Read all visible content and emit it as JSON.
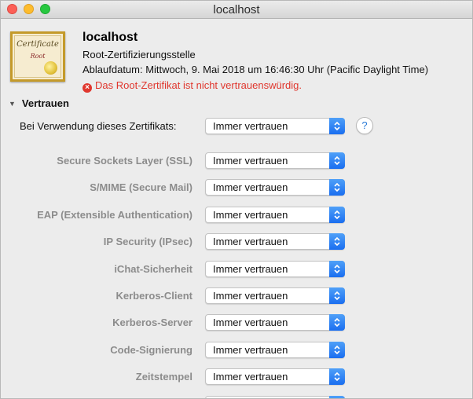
{
  "window": {
    "title": "localhost"
  },
  "certificate": {
    "icon_word": "Certificate",
    "icon_sub": "Root",
    "name": "localhost",
    "kind": "Root-Zertifizierungsstelle",
    "expiry": "Ablaufdatum: Mittwoch, 9. Mai 2018 um 16:46:30 Uhr (Pacific Daylight Time)",
    "status": "Das Root-Zertifikat ist nicht vertrauenswürdig.",
    "status_color": "#e0372e"
  },
  "trust": {
    "section_label": "Vertrauen",
    "main_label": "Bei Verwendung dieses Zertifikats:",
    "main_value": "Immer vertrauen",
    "help_label": "?",
    "rows": [
      {
        "label": "Secure Sockets Layer (SSL)",
        "value": "Immer vertrauen"
      },
      {
        "label": "S/MIME (Secure Mail)",
        "value": "Immer vertrauen"
      },
      {
        "label": "EAP (Extensible Authentication)",
        "value": "Immer vertrauen"
      },
      {
        "label": "IP Security (IPsec)",
        "value": "Immer vertrauen"
      },
      {
        "label": "iChat-Sicherheit",
        "value": "Immer vertrauen"
      },
      {
        "label": "Kerberos-Client",
        "value": "Immer vertrauen"
      },
      {
        "label": "Kerberos-Server",
        "value": "Immer vertrauen"
      },
      {
        "label": "Code-Signierung",
        "value": "Immer vertrauen"
      },
      {
        "label": "Zeitstempel",
        "value": "Immer vertrauen"
      }
    ]
  },
  "colors": {
    "accent": "#1a6ef0",
    "error": "#e0372e"
  }
}
